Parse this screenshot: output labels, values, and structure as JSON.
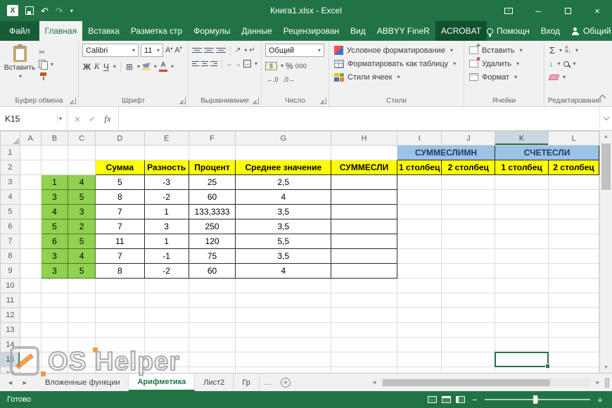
{
  "colors": {
    "accent": "#217346",
    "cell_yellow": "#ffff00",
    "cell_green": "#92d050",
    "cell_blue": "#9cc3e5"
  },
  "titlebar": {
    "title": "Книга1.xlsx - Excel"
  },
  "tabstrip": {
    "file": "Файл",
    "tabs": [
      {
        "label": "Главная",
        "active": true
      },
      {
        "label": "Вставка"
      },
      {
        "label": "Разметка стр"
      },
      {
        "label": "Формулы"
      },
      {
        "label": "Данные"
      },
      {
        "label": "Рецензирован"
      },
      {
        "label": "Вид"
      },
      {
        "label": "ABBYY FineR"
      },
      {
        "label": "ACROBAT",
        "dark": true
      }
    ],
    "help": "Помощн",
    "signin": "Вход",
    "share": "Общий доступ"
  },
  "ribbon": {
    "clipboard": {
      "label": "Буфер обмена",
      "paste": "Вставить"
    },
    "font": {
      "label": "Шрифт",
      "family": "Calibri",
      "size": "11",
      "bold": "Ж",
      "italic": "К",
      "underline": "Ч"
    },
    "alignment": {
      "label": "Выравнивание"
    },
    "number": {
      "label": "Число",
      "format": "Общий",
      "percent": "%",
      "thousands": "000"
    },
    "styles": {
      "label": "Стили",
      "conditional": "Условное форматирование",
      "table": "Форматировать как таблицу",
      "cellstyles": "Стили ячеек"
    },
    "cells": {
      "label": "Ячейки",
      "insert": "Вставить",
      "delete": "Удалить",
      "format": "Формат"
    },
    "editing": {
      "label": "Редактирование",
      "autosum": "Σ"
    }
  },
  "formula_bar": {
    "name_box": "K15",
    "fx": "fx",
    "value": ""
  },
  "sheet": {
    "columns": [
      {
        "label": "A",
        "w": 30
      },
      {
        "label": "B",
        "w": 39
      },
      {
        "label": "C",
        "w": 39
      },
      {
        "label": "D",
        "w": 70
      },
      {
        "label": "E",
        "w": 63
      },
      {
        "label": "F",
        "w": 67
      },
      {
        "label": "G",
        "w": 136
      },
      {
        "label": "H",
        "w": 94
      },
      {
        "label": "I",
        "w": 62
      },
      {
        "label": "J",
        "w": 76
      },
      {
        "label": "K",
        "w": 76
      },
      {
        "label": "L",
        "w": 72
      }
    ],
    "row_count": 16,
    "selected": {
      "col": "K",
      "row": 15
    },
    "cells": [
      {
        "c": "I",
        "r": 1,
        "colspan": 2,
        "t": "СУММЕСЛИМН",
        "s": "blue"
      },
      {
        "c": "K",
        "r": 1,
        "colspan": 2,
        "t": "СЧЕТЕСЛИ",
        "s": "blue"
      },
      {
        "c": "D",
        "r": 2,
        "t": "Сумма",
        "s": "yellow"
      },
      {
        "c": "E",
        "r": 2,
        "t": "Разность",
        "s": "yellow"
      },
      {
        "c": "F",
        "r": 2,
        "t": "Процент",
        "s": "yellow"
      },
      {
        "c": "G",
        "r": 2,
        "t": "Среднее значение",
        "s": "yellow"
      },
      {
        "c": "H",
        "r": 2,
        "t": "СУММЕСЛИ",
        "s": "yellow"
      },
      {
        "c": "I",
        "r": 2,
        "t": "1 столбец",
        "s": "yellow"
      },
      {
        "c": "J",
        "r": 2,
        "t": "2 столбец",
        "s": "yellow"
      },
      {
        "c": "K",
        "r": 2,
        "t": "1 столбец",
        "s": "yellow"
      },
      {
        "c": "L",
        "r": 2,
        "t": "2 столбец",
        "s": "yellow"
      },
      {
        "c": "B",
        "r": 3,
        "t": "1",
        "s": "green"
      },
      {
        "c": "C",
        "r": 3,
        "t": "4",
        "s": "green"
      },
      {
        "c": "D",
        "r": 3,
        "t": "5",
        "s": "data"
      },
      {
        "c": "E",
        "r": 3,
        "t": "-3",
        "s": "data"
      },
      {
        "c": "F",
        "r": 3,
        "t": "25",
        "s": "data"
      },
      {
        "c": "G",
        "r": 3,
        "t": "2,5",
        "s": "data"
      },
      {
        "c": "H",
        "r": 3,
        "t": "",
        "s": "empty"
      },
      {
        "c": "B",
        "r": 4,
        "t": "3",
        "s": "green"
      },
      {
        "c": "C",
        "r": 4,
        "t": "5",
        "s": "green"
      },
      {
        "c": "D",
        "r": 4,
        "t": "8",
        "s": "data"
      },
      {
        "c": "E",
        "r": 4,
        "t": "-2",
        "s": "data"
      },
      {
        "c": "F",
        "r": 4,
        "t": "60",
        "s": "data"
      },
      {
        "c": "G",
        "r": 4,
        "t": "4",
        "s": "data"
      },
      {
        "c": "H",
        "r": 4,
        "t": "",
        "s": "empty"
      },
      {
        "c": "B",
        "r": 5,
        "t": "4",
        "s": "green"
      },
      {
        "c": "C",
        "r": 5,
        "t": "3",
        "s": "green"
      },
      {
        "c": "D",
        "r": 5,
        "t": "7",
        "s": "data"
      },
      {
        "c": "E",
        "r": 5,
        "t": "1",
        "s": "data"
      },
      {
        "c": "F",
        "r": 5,
        "t": "133,3333",
        "s": "data"
      },
      {
        "c": "G",
        "r": 5,
        "t": "3,5",
        "s": "data"
      },
      {
        "c": "H",
        "r": 5,
        "t": "",
        "s": "empty"
      },
      {
        "c": "B",
        "r": 6,
        "t": "5",
        "s": "green"
      },
      {
        "c": "C",
        "r": 6,
        "t": "2",
        "s": "green"
      },
      {
        "c": "D",
        "r": 6,
        "t": "7",
        "s": "data"
      },
      {
        "c": "E",
        "r": 6,
        "t": "3",
        "s": "data"
      },
      {
        "c": "F",
        "r": 6,
        "t": "250",
        "s": "data"
      },
      {
        "c": "G",
        "r": 6,
        "t": "3,5",
        "s": "data"
      },
      {
        "c": "H",
        "r": 6,
        "t": "",
        "s": "empty"
      },
      {
        "c": "B",
        "r": 7,
        "t": "6",
        "s": "green"
      },
      {
        "c": "C",
        "r": 7,
        "t": "5",
        "s": "green"
      },
      {
        "c": "D",
        "r": 7,
        "t": "11",
        "s": "data"
      },
      {
        "c": "E",
        "r": 7,
        "t": "1",
        "s": "data"
      },
      {
        "c": "F",
        "r": 7,
        "t": "120",
        "s": "data"
      },
      {
        "c": "G",
        "r": 7,
        "t": "5,5",
        "s": "data"
      },
      {
        "c": "H",
        "r": 7,
        "t": "",
        "s": "empty"
      },
      {
        "c": "B",
        "r": 8,
        "t": "3",
        "s": "green"
      },
      {
        "c": "C",
        "r": 8,
        "t": "4",
        "s": "green"
      },
      {
        "c": "D",
        "r": 8,
        "t": "7",
        "s": "data"
      },
      {
        "c": "E",
        "r": 8,
        "t": "-1",
        "s": "data"
      },
      {
        "c": "F",
        "r": 8,
        "t": "75",
        "s": "data"
      },
      {
        "c": "G",
        "r": 8,
        "t": "3,5",
        "s": "data"
      },
      {
        "c": "H",
        "r": 8,
        "t": "",
        "s": "empty"
      },
      {
        "c": "B",
        "r": 9,
        "t": "3",
        "s": "green"
      },
      {
        "c": "C",
        "r": 9,
        "t": "5",
        "s": "green"
      },
      {
        "c": "D",
        "r": 9,
        "t": "8",
        "s": "data"
      },
      {
        "c": "E",
        "r": 9,
        "t": "-2",
        "s": "data"
      },
      {
        "c": "F",
        "r": 9,
        "t": "60",
        "s": "data"
      },
      {
        "c": "G",
        "r": 9,
        "t": "4",
        "s": "data"
      },
      {
        "c": "H",
        "r": 9,
        "t": "",
        "s": "empty"
      }
    ]
  },
  "sheet_tabs": {
    "tabs": [
      {
        "label": "Вложенные функции"
      },
      {
        "label": "Арифметика",
        "active": true
      },
      {
        "label": "Лист2"
      },
      {
        "label": "Гр"
      }
    ],
    "overflow": "...",
    "add": "+"
  },
  "status_bar": {
    "ready": "Готово"
  },
  "watermark": {
    "os": "OS",
    "helper": "Helper"
  }
}
